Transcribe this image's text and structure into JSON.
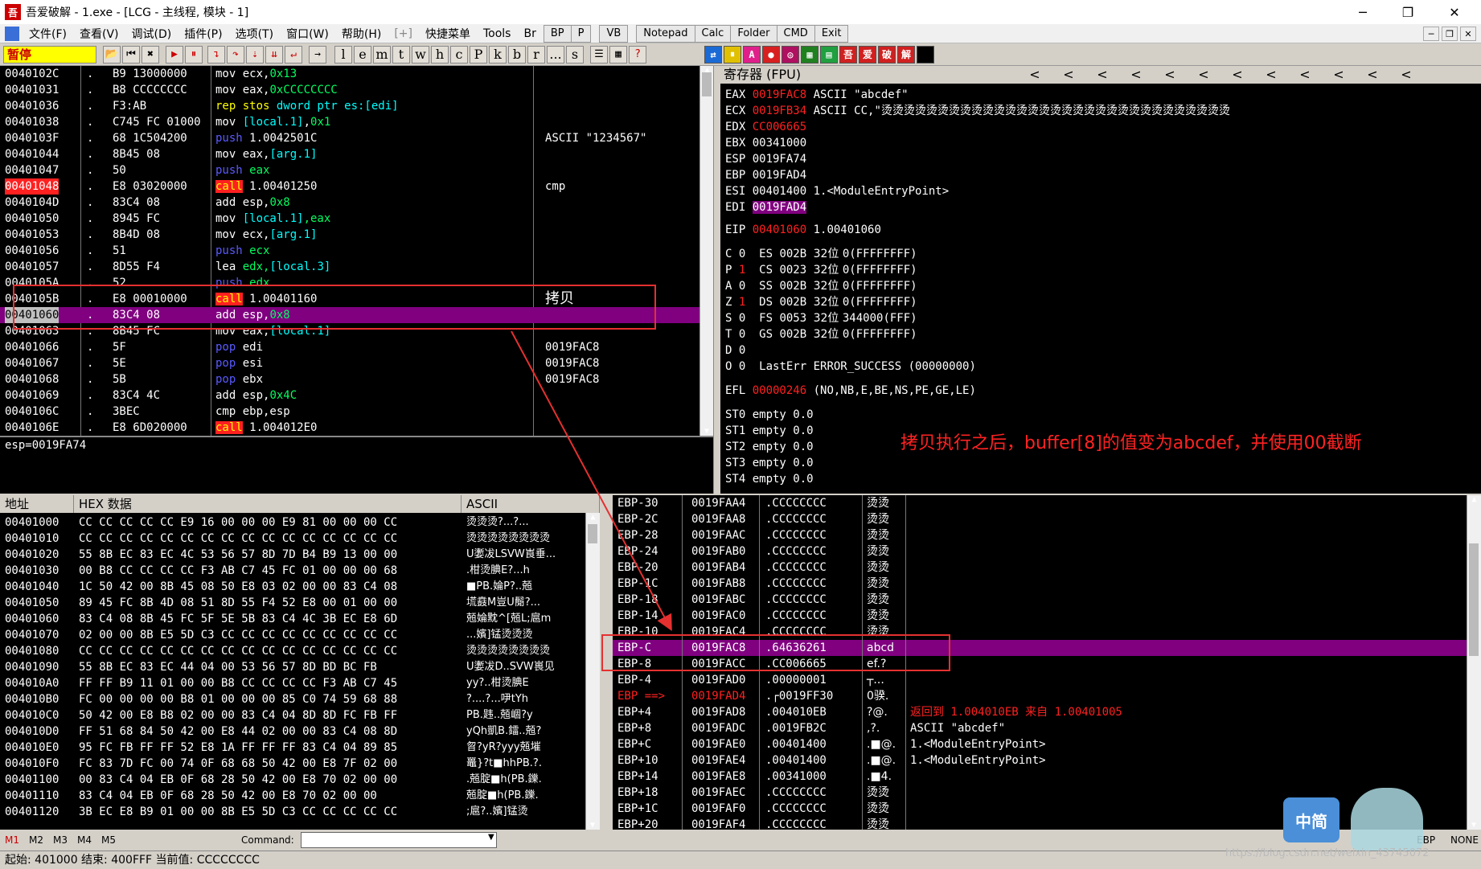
{
  "window": {
    "title": "吾爱破解 - 1.exe - [LCG - 主线程, 模块 - 1]",
    "app_icon": "52pojie-icon",
    "minimize": "─",
    "restore": "❐",
    "close": "✕"
  },
  "menu": {
    "items": [
      "文件(F)",
      "查看(V)",
      "调试(D)",
      "插件(P)",
      "选项(T)",
      "窗口(W)",
      "帮助(H)",
      "[+]",
      "快捷菜单",
      "Tools",
      "Br"
    ],
    "tool_buttons": [
      "BP",
      "P",
      "VB",
      "Notepad",
      "Calc",
      "Folder",
      "CMD",
      "Exit"
    ]
  },
  "toolbar": {
    "status": "暂停",
    "letters": [
      "l",
      "e",
      "m",
      "t",
      "w",
      "h",
      "c",
      "P",
      "k",
      "b",
      "r",
      "...",
      "s"
    ]
  },
  "disasm": {
    "rows": [
      {
        "addr": "0040102C",
        "mark": ".",
        "hex": "B9 13000000",
        "inst": [
          [
            "mov ",
            "w"
          ],
          [
            "ecx,",
            "w"
          ],
          [
            "0x13",
            "o"
          ]
        ],
        "comment": ""
      },
      {
        "addr": "00401031",
        "mark": ".",
        "hex": "B8 CCCCCCCC",
        "inst": [
          [
            "mov ",
            "w"
          ],
          [
            "eax,",
            "w"
          ],
          [
            "0xCCCCCCCC",
            "o"
          ]
        ],
        "comment": ""
      },
      {
        "addr": "00401036",
        "mark": ".",
        "hex": "F3:AB",
        "inst": [
          [
            "rep stos ",
            "y"
          ],
          [
            "dword ptr es:[edi]",
            "c"
          ]
        ],
        "comment": ""
      },
      {
        "addr": "00401038",
        "mark": ".",
        "hex": "C745 FC 01000",
        "inst": [
          [
            "mov ",
            "w"
          ],
          [
            "[local.1]",
            "c"
          ],
          [
            ",",
            "w"
          ],
          [
            "0x1",
            "o"
          ]
        ],
        "comment": ""
      },
      {
        "addr": "0040103F",
        "mark": ".",
        "hex": "68 1C504200",
        "inst": [
          [
            "push ",
            "b"
          ],
          [
            "1.0042501C",
            "w"
          ]
        ],
        "comment": "ASCII \"1234567\""
      },
      {
        "addr": "00401044",
        "mark": ".",
        "hex": "8B45 08",
        "inst": [
          [
            "mov ",
            "w"
          ],
          [
            "eax,",
            "w"
          ],
          [
            "[arg.1]",
            "c"
          ]
        ],
        "comment": ""
      },
      {
        "addr": "00401047",
        "mark": ".",
        "hex": "50",
        "inst": [
          [
            "push ",
            "b"
          ],
          [
            "eax",
            "g"
          ]
        ],
        "comment": ""
      },
      {
        "addr": "00401048",
        "mark": ".",
        "hex": "E8 03020000",
        "inst": [
          [
            "call",
            "call"
          ],
          [
            " 1.00401250",
            "w"
          ]
        ],
        "comment": "cmp",
        "bp": true
      },
      {
        "addr": "0040104D",
        "mark": ".",
        "hex": "83C4 08",
        "inst": [
          [
            "add ",
            "w"
          ],
          [
            "esp,",
            "w"
          ],
          [
            "0x8",
            "o"
          ]
        ],
        "comment": ""
      },
      {
        "addr": "00401050",
        "mark": ".",
        "hex": "8945 FC",
        "inst": [
          [
            "mov ",
            "w"
          ],
          [
            "[local.1]",
            "c"
          ],
          [
            ",eax",
            "g"
          ]
        ],
        "comment": ""
      },
      {
        "addr": "00401053",
        "mark": ".",
        "hex": "8B4D 08",
        "inst": [
          [
            "mov ",
            "w"
          ],
          [
            "ecx,",
            "w"
          ],
          [
            "[arg.1]",
            "c"
          ]
        ],
        "comment": ""
      },
      {
        "addr": "00401056",
        "mark": ".",
        "hex": "51",
        "inst": [
          [
            "push ",
            "b"
          ],
          [
            "ecx",
            "g"
          ]
        ],
        "comment": ""
      },
      {
        "addr": "00401057",
        "mark": ".",
        "hex": "8D55 F4",
        "inst": [
          [
            "lea ",
            "w"
          ],
          [
            "edx,",
            "g"
          ],
          [
            "[local.3]",
            "c"
          ]
        ],
        "comment": ""
      },
      {
        "addr": "0040105A",
        "mark": ".",
        "hex": "52",
        "inst": [
          [
            "push ",
            "b"
          ],
          [
            "edx",
            "g"
          ]
        ],
        "comment": ""
      },
      {
        "addr": "0040105B",
        "mark": ".",
        "hex": "E8 00010000",
        "inst": [
          [
            "call",
            "call"
          ],
          [
            " 1.00401160",
            "w"
          ]
        ],
        "comment": "拷贝"
      },
      {
        "addr": "00401060",
        "mark": ".",
        "hex": "83C4 08",
        "inst": [
          [
            "add ",
            "w"
          ],
          [
            "esp,",
            "w"
          ],
          [
            "0x8",
            "o"
          ]
        ],
        "comment": "",
        "cur": true
      },
      {
        "addr": "00401063",
        "mark": ".",
        "hex": "8B45 FC",
        "inst": [
          [
            "mov ",
            "w"
          ],
          [
            "eax,",
            "w"
          ],
          [
            "[local.1]",
            "c"
          ]
        ],
        "comment": ""
      },
      {
        "addr": "00401066",
        "mark": ".",
        "hex": "5F",
        "inst": [
          [
            "pop ",
            "b"
          ],
          [
            "edi",
            "w"
          ]
        ],
        "comment": "0019FAC8"
      },
      {
        "addr": "00401067",
        "mark": ".",
        "hex": "5E",
        "inst": [
          [
            "pop ",
            "b"
          ],
          [
            "esi",
            "w"
          ]
        ],
        "comment": "0019FAC8"
      },
      {
        "addr": "00401068",
        "mark": ".",
        "hex": "5B",
        "inst": [
          [
            "pop ",
            "b"
          ],
          [
            "ebx",
            "w"
          ]
        ],
        "comment": "0019FAC8"
      },
      {
        "addr": "00401069",
        "mark": ".",
        "hex": "83C4 4C",
        "inst": [
          [
            "add ",
            "w"
          ],
          [
            "esp,",
            "w"
          ],
          [
            "0x4C",
            "o"
          ]
        ],
        "comment": ""
      },
      {
        "addr": "0040106C",
        "mark": ".",
        "hex": "3BEC",
        "inst": [
          [
            "cmp ",
            "w"
          ],
          [
            "ebp,esp",
            "w"
          ]
        ],
        "comment": ""
      },
      {
        "addr": "0040106E",
        "mark": ".",
        "hex": "E8 6D020000",
        "inst": [
          [
            "call",
            "call"
          ],
          [
            " 1.004012E0",
            "w"
          ]
        ],
        "comment": ""
      }
    ],
    "info": "esp=0019FA74"
  },
  "registers": {
    "header": "寄存器 (FPU)",
    "gp": [
      {
        "name": "EAX",
        "val": "0019FAC8",
        "red": true,
        "desc": "ASCII \"abcdef\""
      },
      {
        "name": "ECX",
        "val": "0019FB34",
        "red": true,
        "desc": "ASCII CC,\"烫烫烫烫烫烫烫烫烫烫烫烫烫烫烫烫烫烫烫烫烫烫烫烫烫烫烫烫烫烫烫"
      },
      {
        "name": "EDX",
        "val": "CC006665",
        "red": true,
        "desc": ""
      },
      {
        "name": "EBX",
        "val": "00341000",
        "red": false,
        "desc": ""
      },
      {
        "name": "ESP",
        "val": "0019FA74",
        "red": false,
        "desc": ""
      },
      {
        "name": "EBP",
        "val": "0019FAD4",
        "red": false,
        "desc": ""
      },
      {
        "name": "ESI",
        "val": "00401400",
        "red": false,
        "desc": "1.<ModuleEntryPoint>"
      },
      {
        "name": "EDI",
        "val": "0019FAD4",
        "red": false,
        "desc": "",
        "hl": true
      }
    ],
    "eip": {
      "name": "EIP",
      "val": "00401060",
      "desc": "1.00401060"
    },
    "flags": [
      {
        "f": "C",
        "v": "0",
        "seg": "ES",
        "sv": "002B",
        "bits": "32位",
        "range": "0(FFFFFFFF)"
      },
      {
        "f": "P",
        "v": "1",
        "red": true,
        "seg": "CS",
        "sv": "0023",
        "bits": "32位",
        "range": "0(FFFFFFFF)"
      },
      {
        "f": "A",
        "v": "0",
        "seg": "SS",
        "sv": "002B",
        "bits": "32位",
        "range": "0(FFFFFFFF)"
      },
      {
        "f": "Z",
        "v": "1",
        "red": true,
        "seg": "DS",
        "sv": "002B",
        "bits": "32位",
        "range": "0(FFFFFFFF)"
      },
      {
        "f": "S",
        "v": "0",
        "seg": "FS",
        "sv": "0053",
        "bits": "32位",
        "range": "344000(FFF)"
      },
      {
        "f": "T",
        "v": "0",
        "seg": "GS",
        "sv": "002B",
        "bits": "32位",
        "range": "0(FFFFFFFF)"
      },
      {
        "f": "D",
        "v": "0",
        "seg": "",
        "sv": "",
        "bits": "",
        "range": ""
      },
      {
        "f": "O",
        "v": "0",
        "seg": "LastErr",
        "sv": "ERROR_SUCCESS (00000000)",
        "bits": "",
        "range": ""
      }
    ],
    "efl": {
      "name": "EFL",
      "val": "00000246",
      "desc": "(NO,NB,E,BE,NS,PE,GE,LE)"
    },
    "fpu": [
      "ST0 empty 0.0",
      "ST1 empty 0.0",
      "ST2 empty 0.0",
      "ST3 empty 0.0",
      "ST4 empty 0.0"
    ],
    "nav_arrows": [
      "<",
      "<",
      "<",
      "<",
      "<",
      "<",
      "<",
      "<",
      "<",
      "<",
      "<",
      "<"
    ]
  },
  "annotation_main": "拷贝执行之后，buffer[8]的值变为abcdef，并使用00截断",
  "dump": {
    "headers": [
      "地址",
      "HEX 数据",
      "ASCII"
    ],
    "rows": [
      [
        "00401000",
        "CC CC CC CC CC E9 16 00 00 00 E9 81 00 00 00 CC",
        "烫烫烫?...?..."
      ],
      [
        "00401010",
        "CC CC CC CC CC CC CC CC CC CC CC CC CC CC CC CC",
        "烫烫烫烫烫烫烫烫"
      ],
      [
        "00401020",
        "55 8B EC 83 EC 4C 53 56 57 8D 7D B4 B9 13 00 00",
        "U嬱冹LSVW崀垂..."
      ],
      [
        "00401030",
        "00 B8 CC CC CC CC F3 AB C7 45 FC 01 00 00 00 68",
        ".柑烫腆E?...h"
      ],
      [
        "00401040",
        "1C 50 42 00 8B 45 08 50 E8 03 02 00 00 83 C4 08",
        "■PB.婨P?..兡"
      ],
      [
        "00401050",
        "89 45 FC 8B 4D 08 51 8D 55 F4 52 E8 00 01 00 00",
        "塃鼖M豈U鬜?..."
      ],
      [
        "00401060",
        "83 C4 08 8B 45 FC 5F 5E 5B 83 C4 4C 3B EC E8 6D",
        "兡婨黕^[兡L;扈m"
      ],
      [
        "00401070",
        "02 00 00 8B E5 5D C3 CC CC CC CC CC CC CC CC CC",
        "...嬪]锰烫烫烫"
      ],
      [
        "00401080",
        "CC CC CC CC CC CC CC CC CC CC CC CC CC CC CC CC",
        "烫烫烫烫烫烫烫烫"
      ],
      [
        "00401090",
        "55 8B EC 83 EC 44 04 00 53 56 57 8D BD BC FB",
        "U嬱冹D..SVW嵔见"
      ],
      [
        "004010A0",
        "FF FF B9 11 01 00 00 B8 CC CC CC CC F3 AB C7 45",
        "yy?..柑烫腆E"
      ],
      [
        "004010B0",
        "FC 00 00 00 00 B8 01 00 00 00 85 C0 74 59 68 88",
        "?....?...吚tYh"
      ],
      [
        "004010C0",
        "50 42 00 E8 B8 02 00 00 83 C4 04 8D 8D FC FB FF",
        "PB.韪..兡崓?y"
      ],
      [
        "004010D0",
        "FF 51 68 84 50 42 00 E8 44 02 00 00 83 C4 08 8D",
        "yQh凱B.鐳..兡?"
      ],
      [
        "004010E0",
        "95 FC FB FF FF 52 E8 1A FF FF FF 83 C4 04 89 85",
        "曶?yR?yyy兡墔"
      ],
      [
        "004010F0",
        "FC 83 7D FC 00 74 0F 68 68 50 42 00 E8 7F 02 00",
        "鼉}?t■hhPB.?."
      ],
      [
        "00401100",
        "00 83 C4 04 EB 0F 68 28 50 42 00 E8 70 02 00 00",
        ".兡腚■h(PB.鑠."
      ],
      [
        "00401110",
        "83 C4 04 EB 0F 68 28 50 42 00 E8 70 02 00 00",
        "兡腚■h(PB.鑠."
      ],
      [
        "00401120",
        "3B EC E8 B9 01 00 00 8B E5 5D C3 CC CC CC CC CC",
        ";扈?..嬪]锰烫"
      ]
    ]
  },
  "stack": {
    "rows": [
      {
        "off": "EBP-30",
        "addr": "0019FAA4",
        "val": "CCCCCCCC",
        "asc": "烫烫",
        "note": ""
      },
      {
        "off": "EBP-2C",
        "addr": "0019FAA8",
        "val": "CCCCCCCC",
        "asc": "烫烫",
        "note": ""
      },
      {
        "off": "EBP-28",
        "addr": "0019FAAC",
        "val": "CCCCCCCC",
        "asc": "烫烫",
        "note": ""
      },
      {
        "off": "EBP-24",
        "addr": "0019FAB0",
        "val": "CCCCCCCC",
        "asc": "烫烫",
        "note": ""
      },
      {
        "off": "EBP-20",
        "addr": "0019FAB4",
        "val": "CCCCCCCC",
        "asc": "烫烫",
        "note": ""
      },
      {
        "off": "EBP-1C",
        "addr": "0019FAB8",
        "val": "CCCCCCCC",
        "asc": "烫烫",
        "note": ""
      },
      {
        "off": "EBP-18",
        "addr": "0019FABC",
        "val": "CCCCCCCC",
        "asc": "烫烫",
        "note": ""
      },
      {
        "off": "EBP-14",
        "addr": "0019FAC0",
        "val": "CCCCCCCC",
        "asc": "烫烫",
        "note": ""
      },
      {
        "off": "EBP-10",
        "addr": "0019FAC4",
        "val": "CCCCCCCC",
        "asc": "烫烫",
        "note": ""
      },
      {
        "off": "EBP-C",
        "addr": "0019FAC8",
        "val": "64636261",
        "asc": "abcd",
        "note": "",
        "hl": true
      },
      {
        "off": "EBP-8",
        "addr": "0019FACC",
        "val": "CC006665",
        "asc": "ef.?",
        "note": ""
      },
      {
        "off": "EBP-4",
        "addr": "0019FAD0",
        "val": "00000001",
        "asc": "┬...",
        "note": ""
      },
      {
        "off": "EBP ==>",
        "addr": "0019FAD4",
        "val": "┌0019FF30",
        "asc": "0骙.",
        "note": "",
        "red": true
      },
      {
        "off": "EBP+4",
        "addr": "0019FAD8",
        "val": "004010EB",
        "asc": "?@.",
        "note": "返回到 1.004010EB 来自 1.00401005",
        "notered": true
      },
      {
        "off": "EBP+8",
        "addr": "0019FADC",
        "val": "0019FB2C",
        "asc": ",?.",
        "note": "ASCII \"abcdef\""
      },
      {
        "off": "EBP+C",
        "addr": "0019FAE0",
        "val": "00401400",
        "asc": ".■@.",
        "note": "1.<ModuleEntryPoint>"
      },
      {
        "off": "EBP+10",
        "addr": "0019FAE4",
        "val": "00401400",
        "asc": ".■@.",
        "note": "1.<ModuleEntryPoint>"
      },
      {
        "off": "EBP+14",
        "addr": "0019FAE8",
        "val": "00341000",
        "asc": ".■4.",
        "note": ""
      },
      {
        "off": "EBP+18",
        "addr": "0019FAEC",
        "val": "CCCCCCCC",
        "asc": "烫烫",
        "note": ""
      },
      {
        "off": "EBP+1C",
        "addr": "0019FAF0",
        "val": "CCCCCCCC",
        "asc": "烫烫",
        "note": ""
      },
      {
        "off": "EBP+20",
        "addr": "0019FAF4",
        "val": "CCCCCCCC",
        "asc": "烫烫",
        "note": ""
      }
    ]
  },
  "cmdbar": {
    "marks": [
      "M1",
      "M2",
      "M3",
      "M4",
      "M5"
    ],
    "label": "Command:",
    "right": [
      "EBP",
      "NONE"
    ]
  },
  "status": {
    "text": "起始: 401000 结束: 400FFF 当前值: CCCCCCCC"
  },
  "watermark": "https://blog.csdn.net/weixin_43745072",
  "ime": "中简"
}
